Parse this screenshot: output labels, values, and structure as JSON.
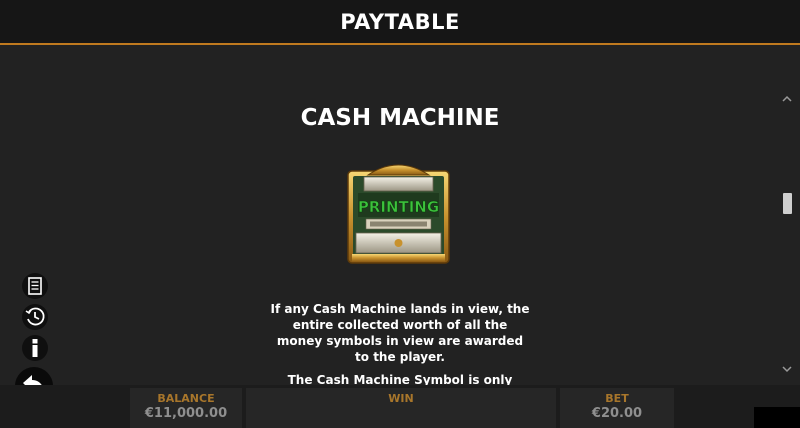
{
  "header": {
    "title": "PAYTABLE"
  },
  "section": {
    "title": "CASH MACHINE",
    "symbol_label": "PRINTING",
    "description": "If any Cash Machine lands in view, the entire collected worth of all the money symbols in view are awarded to the player.",
    "next_text": "The Cash Machine Symbol is only"
  },
  "side_menu": {
    "icons": [
      "paytable-icon",
      "history-icon",
      "info-icon",
      "back-icon"
    ]
  },
  "footer": {
    "balance_label": "BALANCE",
    "balance_value": "€11,000.00",
    "win_label": "WIN",
    "win_value": "",
    "bet_label": "BET",
    "bet_value": "€20.00"
  },
  "colors": {
    "accent": "#c07a1f",
    "footer_label": "#a8762b",
    "background": "#222222"
  }
}
